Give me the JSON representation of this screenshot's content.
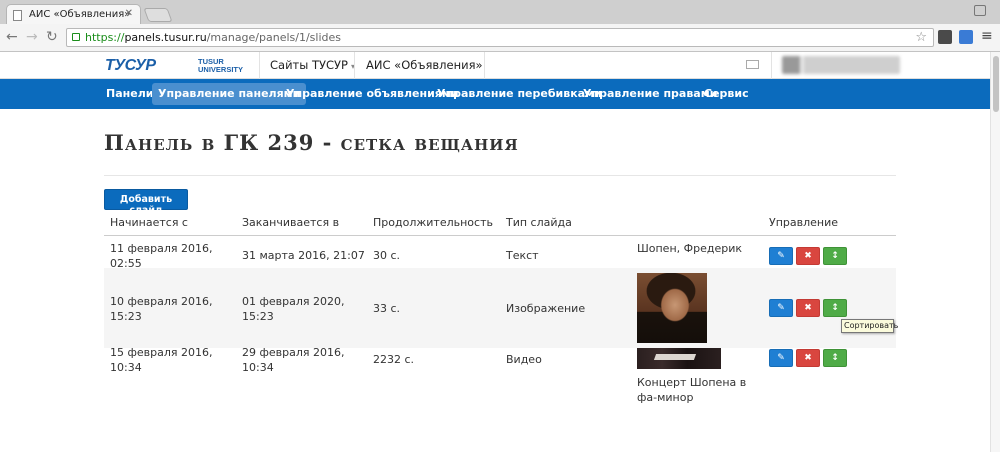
{
  "browser": {
    "tab_title": "АИС «Объявления»",
    "url_scheme": "https://",
    "url_host": "panels.tusur.ru",
    "url_path": "/manage/panels/1/slides"
  },
  "header": {
    "logo_text": "ТУСУР",
    "logo_sub": "TUSUR UNIVERSITY",
    "sites_link": "Сайты ТУСУР",
    "app_title": "АИС «Объявления»"
  },
  "nav": {
    "items": [
      "Панели",
      "Управление панелями",
      "Управление объявлениями",
      "Управление перебивками",
      "Управление правами",
      "Сервис"
    ],
    "active": "Управление панелями"
  },
  "page": {
    "title": "Панель в ГК 239 - сетка вещания",
    "add_button": "Добавить слайд"
  },
  "table": {
    "headers": [
      "Начинается с",
      "Заканчивается в",
      "Продолжительность",
      "Тип слайда",
      "",
      "Управление"
    ],
    "rows": [
      {
        "start": "11 февраля 2016, 02:55",
        "end": "31 марта 2016, 21:07",
        "duration": "30 с.",
        "type": "Текст",
        "content": "Шопен, Фредерик"
      },
      {
        "start": "10 февраля 2016, 15:23",
        "end": "01 февраля 2020, 15:23",
        "duration": "33 с.",
        "type": "Изображение",
        "content": ""
      },
      {
        "start": "15 февраля 2016, 10:34",
        "end": "29 февраля 2016, 10:34",
        "duration": "2232 с.",
        "type": "Видео",
        "content": "Концерт Шопена в фа-минор"
      }
    ]
  },
  "actions": {
    "edit_icon": "pencil-icon",
    "delete_icon": "times-icon",
    "sort_icon": "arrows-v-icon"
  },
  "tooltip": "Сортировать",
  "colors": {
    "navbar": "#0b6bbd",
    "edit": "#1f7fd3",
    "delete": "#d9463f",
    "sort": "#4fab47"
  }
}
